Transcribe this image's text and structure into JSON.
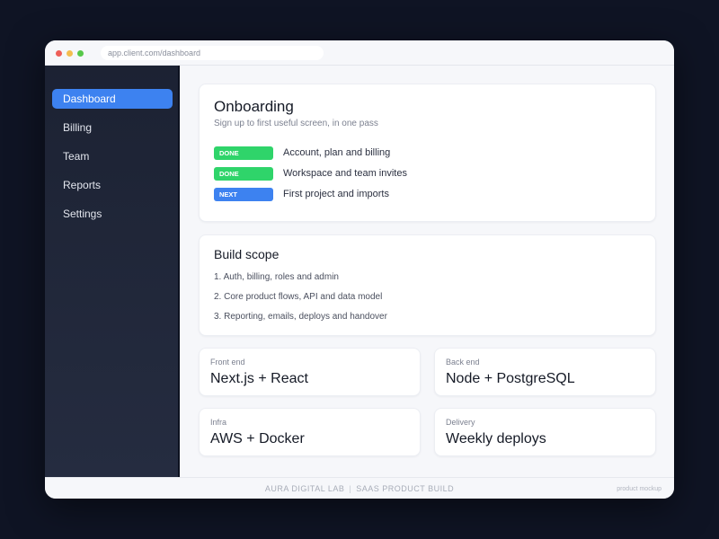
{
  "browser": {
    "url": "app.client.com/dashboard"
  },
  "sidebar": {
    "items": [
      {
        "label": "Dashboard",
        "active": true
      },
      {
        "label": "Billing",
        "active": false
      },
      {
        "label": "Team",
        "active": false
      },
      {
        "label": "Reports",
        "active": false
      },
      {
        "label": "Settings",
        "active": false
      }
    ]
  },
  "onboarding": {
    "title": "Onboarding",
    "subtitle": "Sign up to first useful screen, in one pass",
    "steps": [
      {
        "status": "DONE",
        "label": "Account, plan and billing",
        "color": "#2fd46a"
      },
      {
        "status": "DONE",
        "label": "Workspace and team invites",
        "color": "#2fd46a"
      },
      {
        "status": "NEXT",
        "label": "First project and imports",
        "color": "#3d82f0"
      }
    ]
  },
  "scope": {
    "title": "Build scope",
    "items": [
      "1.  Auth, billing, roles and admin",
      "2.  Core product flows, API and data model",
      "3.  Reporting, emails, deploys and handover"
    ]
  },
  "stack": [
    {
      "label": "Front end",
      "value": "Next.js + React"
    },
    {
      "label": "Back end",
      "value": "Node + PostgreSQL"
    },
    {
      "label": "Infra",
      "value": "AWS + Docker"
    },
    {
      "label": "Delivery",
      "value": "Weekly deploys"
    }
  ],
  "footer": {
    "brand": "AURA DIGITAL LAB",
    "separator": "|",
    "tagline": "SAAS PRODUCT BUILD",
    "right_text": "product mockup"
  },
  "colors": {
    "accent": "#3d82f0",
    "done": "#2fd46a",
    "sidebar_bg": "#1c2233",
    "page_bg": "#0f1424"
  }
}
